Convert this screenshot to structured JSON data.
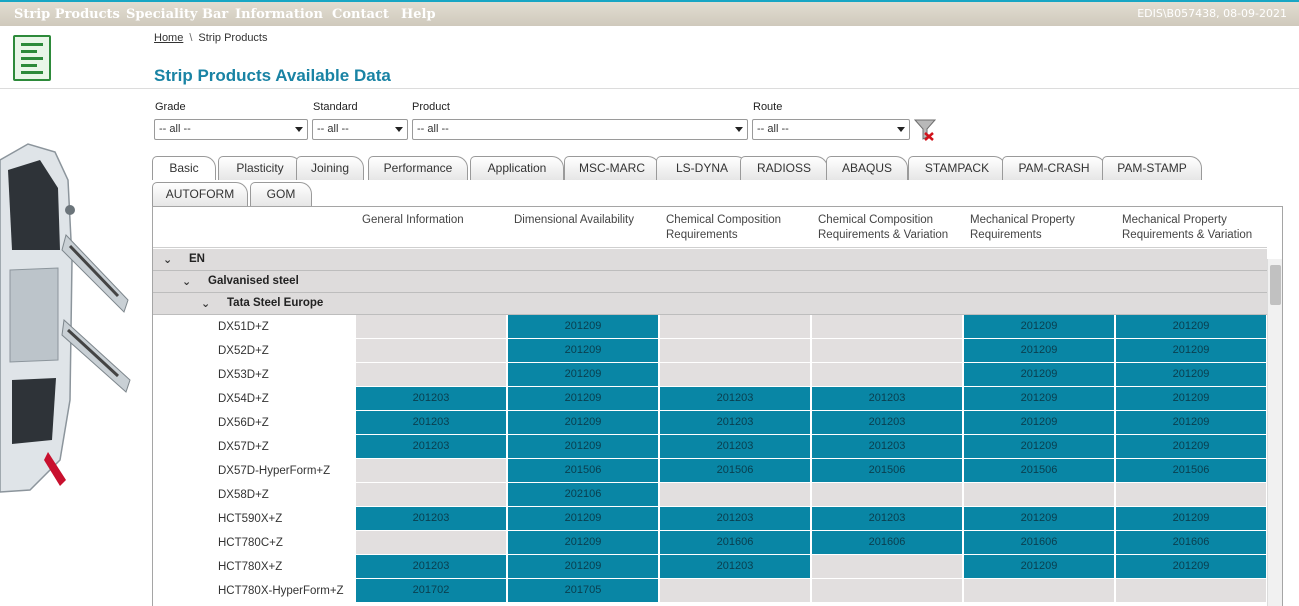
{
  "nav": {
    "items": [
      "Strip Products",
      "Speciality Bar",
      "Information",
      "Contact",
      "Help"
    ],
    "user_info": "EDIS\\B057438, 08-09-2021"
  },
  "breadcrumb": {
    "home": "Home",
    "current": "Strip Products"
  },
  "page_title": "Strip Products Available Data",
  "filters": {
    "grade": {
      "label": "Grade",
      "value": "-- all --"
    },
    "standard": {
      "label": "Standard",
      "value": "-- all --"
    },
    "product": {
      "label": "Product",
      "value": "-- all --"
    },
    "route": {
      "label": "Route",
      "value": "-- all --"
    }
  },
  "tabs": [
    "Basic",
    "Plasticity",
    "Joining",
    "Performance",
    "Application",
    "MSC-MARC",
    "LS-DYNA",
    "RADIOSS",
    "ABAQUS",
    "STAMPACK",
    "PAM-CRASH",
    "PAM-STAMP",
    "AUTOFORM",
    "GOM"
  ],
  "active_tab": "Basic",
  "columns": [
    [
      "General Information",
      ""
    ],
    [
      "Dimensional Availability",
      ""
    ],
    [
      "Chemical Composition",
      "Requirements"
    ],
    [
      "Chemical Composition",
      "Requirements & Variation"
    ],
    [
      "Mechanical Property",
      "Requirements"
    ],
    [
      "Mechanical Property",
      "Requirements & Variation"
    ]
  ],
  "groups": {
    "standard": "EN",
    "material": "Galvanised steel",
    "supplier": "Tata Steel Europe"
  },
  "rows": [
    {
      "grade": "DX51D+Z",
      "cells": [
        "",
        "201209",
        "",
        "",
        "201209",
        "201209"
      ]
    },
    {
      "grade": "DX52D+Z",
      "cells": [
        "",
        "201209",
        "",
        "",
        "201209",
        "201209"
      ]
    },
    {
      "grade": "DX53D+Z",
      "cells": [
        "",
        "201209",
        "",
        "",
        "201209",
        "201209"
      ]
    },
    {
      "grade": "DX54D+Z",
      "cells": [
        "201203",
        "201209",
        "201203",
        "201203",
        "201209",
        "201209"
      ]
    },
    {
      "grade": "DX56D+Z",
      "cells": [
        "201203",
        "201209",
        "201203",
        "201203",
        "201209",
        "201209"
      ]
    },
    {
      "grade": "DX57D+Z",
      "cells": [
        "201203",
        "201209",
        "201203",
        "201203",
        "201209",
        "201209"
      ]
    },
    {
      "grade": "DX57D-HyperForm+Z",
      "cells": [
        "",
        "201506",
        "201506",
        "201506",
        "201506",
        "201506"
      ]
    },
    {
      "grade": "DX58D+Z",
      "cells": [
        "",
        "202106",
        "",
        "",
        "",
        ""
      ]
    },
    {
      "grade": "HCT590X+Z",
      "cells": [
        "201203",
        "201209",
        "201203",
        "201203",
        "201209",
        "201209"
      ]
    },
    {
      "grade": "HCT780C+Z",
      "cells": [
        "",
        "201209",
        "201606",
        "201606",
        "201606",
        "201606"
      ]
    },
    {
      "grade": "HCT780X+Z",
      "cells": [
        "201203",
        "201209",
        "201203",
        "",
        "201209",
        "201209"
      ]
    },
    {
      "grade": "HCT780X-HyperForm+Z",
      "cells": [
        "201702",
        "201705",
        "",
        "",
        "",
        ""
      ]
    }
  ],
  "colors": {
    "accent": "#0986a5",
    "title": "#1983a4",
    "empty_cell": "#e2dfdf"
  }
}
